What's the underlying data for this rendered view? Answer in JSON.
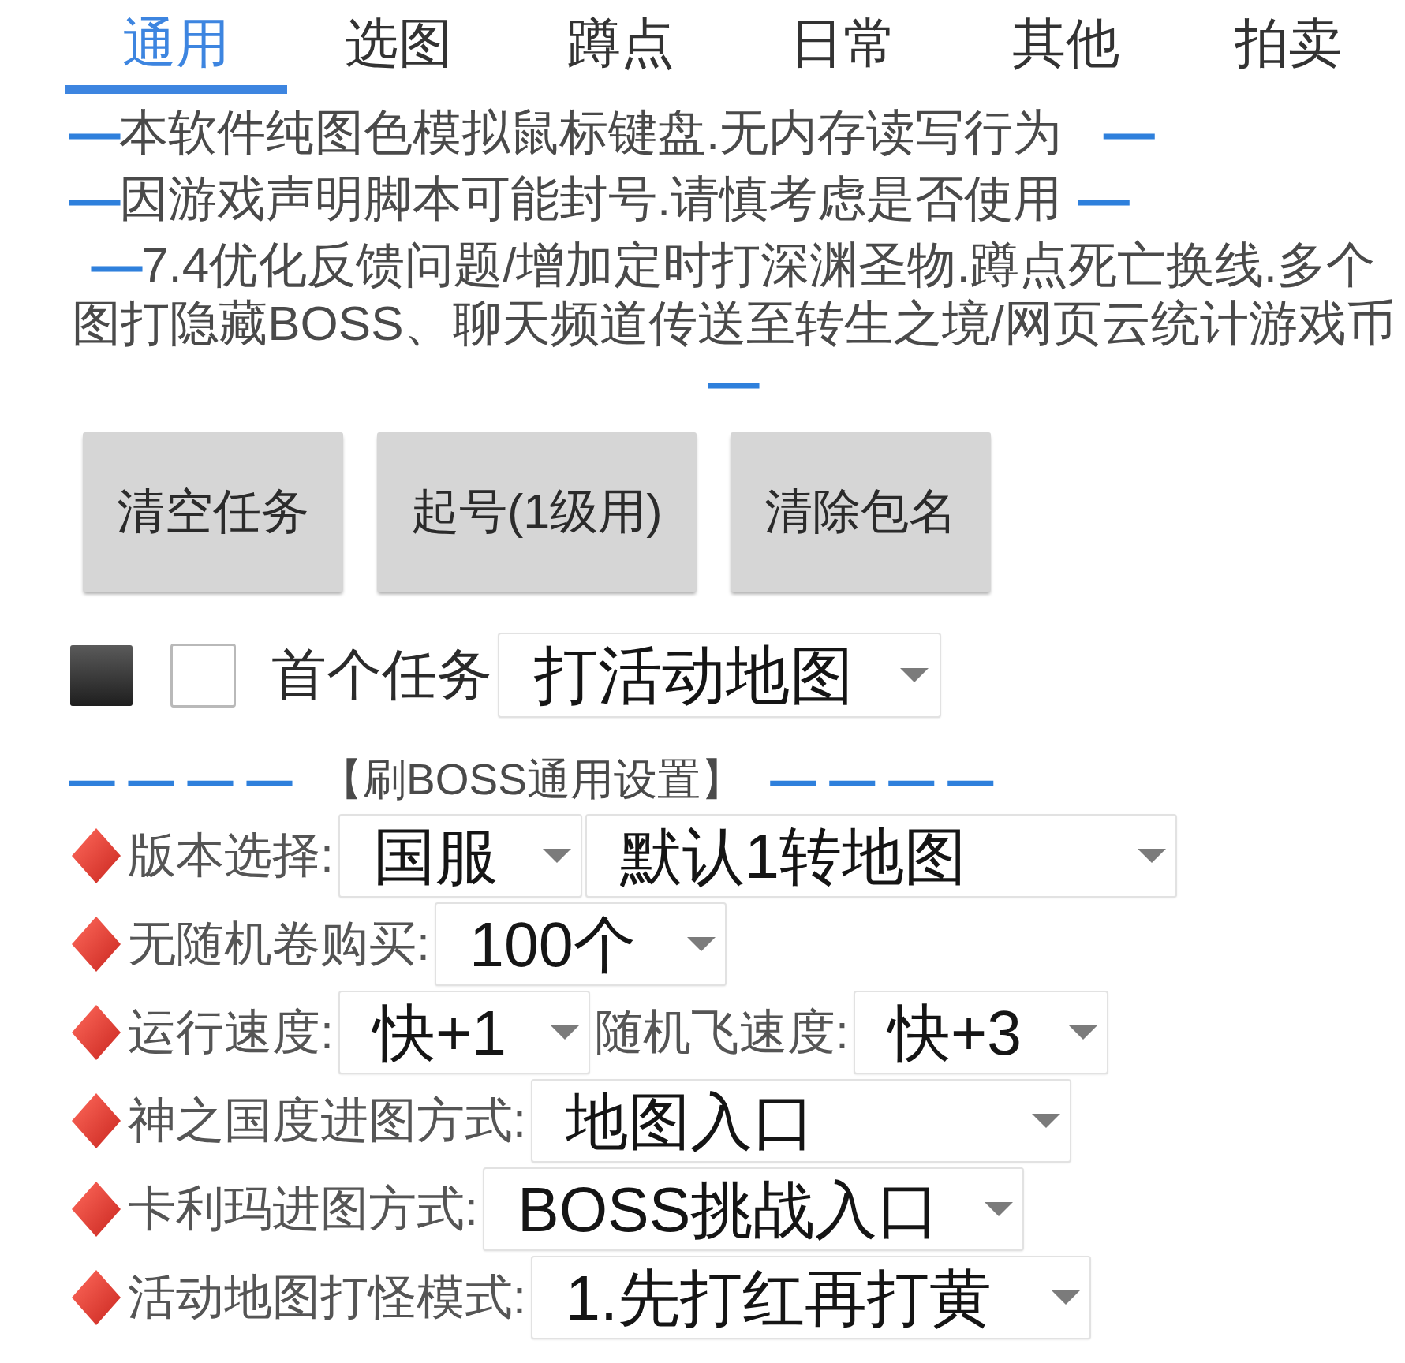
{
  "tabs": [
    {
      "label": "通用",
      "selected": true
    },
    {
      "label": "选图",
      "selected": false
    },
    {
      "label": "蹲点",
      "selected": false
    },
    {
      "label": "日常",
      "selected": false
    },
    {
      "label": "其他",
      "selected": false
    },
    {
      "label": "拍卖",
      "selected": false
    }
  ],
  "notices": [
    {
      "segments": [
        {
          "kind": "dash",
          "text": "—"
        },
        {
          "kind": "text",
          "text": "本软件纯图色模拟鼠标键盘.无内存读写行为"
        },
        {
          "kind": "dash",
          "text": "—"
        }
      ]
    },
    {
      "segments": [
        {
          "kind": "dash",
          "text": "—"
        },
        {
          "kind": "text",
          "text": "因游戏声明脚本可能封号.请慎考虑是否使用"
        },
        {
          "kind": "dash",
          "text": "—"
        }
      ]
    },
    {
      "segments": [
        {
          "kind": "dash",
          "text": "—"
        },
        {
          "kind": "text",
          "text": "7.4优化反馈问题/增加定时打深渊圣物.蹲点死亡换线.多个图打隐藏BOSS、聊天频道传送至转生之境/网页云统计游戏币"
        },
        {
          "kind": "dash",
          "text": "—"
        }
      ]
    }
  ],
  "buttons": [
    "清空任务",
    "起号(1级用)",
    "清除包名"
  ],
  "first_task": {
    "checked": false,
    "label": "首个任务",
    "dropdown": {
      "value": "打活动地图"
    }
  },
  "section": {
    "dashes_left": "————",
    "title": "【刷BOSS通用设置】",
    "dashes_right": "————"
  },
  "settings": [
    {
      "items": [
        {
          "kind": "label",
          "text": "版本选择:"
        },
        {
          "kind": "dropdown",
          "value": "国服"
        },
        {
          "kind": "dropdown",
          "value": "默认1转地图"
        }
      ]
    },
    {
      "items": [
        {
          "kind": "label",
          "text": "无随机卷购买:"
        },
        {
          "kind": "dropdown",
          "value": "100个"
        }
      ]
    },
    {
      "items": [
        {
          "kind": "label",
          "text": "运行速度:"
        },
        {
          "kind": "dropdown",
          "value": "快+1"
        },
        {
          "kind": "label",
          "text": "随机飞速度:"
        },
        {
          "kind": "dropdown",
          "value": "快+3"
        }
      ]
    },
    {
      "items": [
        {
          "kind": "label",
          "text": "神之国度进图方式:"
        },
        {
          "kind": "dropdown",
          "value": "地图入口"
        }
      ]
    },
    {
      "items": [
        {
          "kind": "label",
          "text": "卡利玛进图方式:"
        },
        {
          "kind": "dropdown",
          "value": "BOSS挑战入口"
        }
      ]
    },
    {
      "items": [
        {
          "kind": "label",
          "text": "活动地图打怪模式:"
        },
        {
          "kind": "dropdown",
          "value": "1.先打红再打黄"
        }
      ]
    }
  ]
}
